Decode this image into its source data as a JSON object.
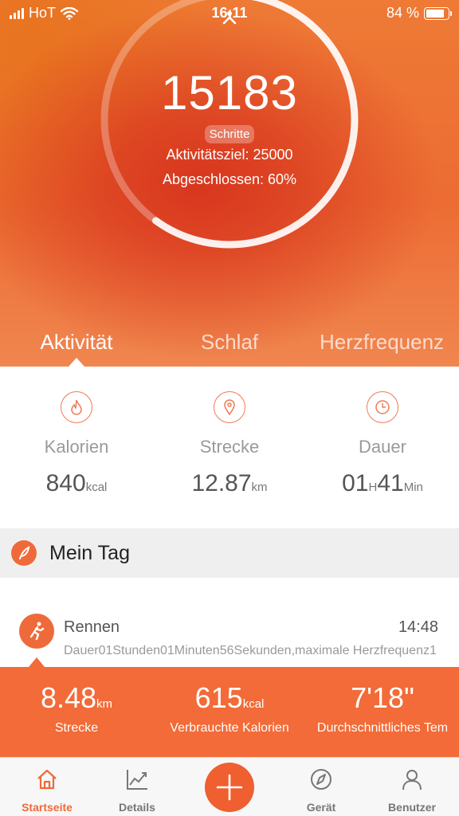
{
  "status_bar": {
    "carrier": "HoT",
    "time": "16:11",
    "battery_percent": "84 %",
    "battery_level": 0.84
  },
  "hero": {
    "steps": "15183",
    "steps_label": "Schritte",
    "goal": "Aktivitätsziel: 25000",
    "completed": "Abgeschlossen: 60%",
    "progress_fraction": 0.6
  },
  "tabs": [
    {
      "label": "Aktivität",
      "active": true
    },
    {
      "label": "Schlaf",
      "active": false
    },
    {
      "label": "Herzfrequenz",
      "active": false
    }
  ],
  "stats": {
    "calories": {
      "label": "Kalorien",
      "value": "840",
      "unit": "kcal",
      "icon": "flame-icon"
    },
    "distance": {
      "label": "Strecke",
      "value": "12.87",
      "unit": "km",
      "icon": "location-pin-icon"
    },
    "duration": {
      "label": "Dauer",
      "hours": "01",
      "hours_unit": "H",
      "minutes": "41",
      "minutes_unit": "Min",
      "icon": "clock-icon"
    }
  },
  "mein_tag": {
    "title": "Mein Tag",
    "icon": "feather-icon"
  },
  "activity": {
    "title": "Rennen",
    "time": "14:48",
    "description": "Dauer01Stunden01Minuten56Sekunden,maximale Herzfrequenz1",
    "icon": "runner-icon"
  },
  "summary": {
    "distance": {
      "value": "8.48",
      "unit": "km",
      "label": "Strecke"
    },
    "calories": {
      "value": "615",
      "unit": "kcal",
      "label": "Verbrauchte Kalorien"
    },
    "pace": {
      "value": "7'18\"",
      "label": "Durchschnittliches Tem"
    }
  },
  "nav": {
    "home": "Startseite",
    "details": "Details",
    "device": "Gerät",
    "user": "Benutzer"
  },
  "colors": {
    "accent": "#ef6a3a",
    "hero_red": "#d8361e",
    "summary_bg": "#f26b38"
  }
}
